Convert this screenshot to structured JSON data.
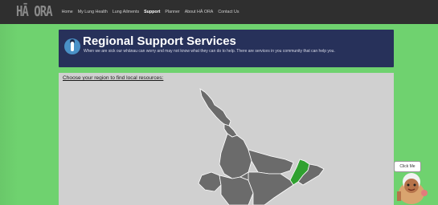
{
  "nav": {
    "logo": "HĀ ORA",
    "items": [
      {
        "label": "Home",
        "active": false
      },
      {
        "label": "My Lung Health",
        "active": false
      },
      {
        "label": "Lung Ailments",
        "active": false
      },
      {
        "label": "Support",
        "active": true
      },
      {
        "label": "Planner",
        "active": false
      },
      {
        "label": "About HĀ ORA",
        "active": false
      },
      {
        "label": "Contact Us",
        "active": false
      }
    ]
  },
  "banner": {
    "title": "Regional Support Services",
    "subtitle": "When we are sick our whānau can worry and may not know what they can do to help. There are services in you community that can help you."
  },
  "content": {
    "prompt": "Choose your region to find local resources:"
  },
  "map": {
    "highlighted_region_color": "#2fa12f",
    "region_color": "#6b6b6b"
  },
  "assistant": {
    "bubble": "Click Me"
  },
  "colors": {
    "background": "#6fd26f",
    "navbar": "#2f2f2f",
    "banner": "#27315a"
  }
}
